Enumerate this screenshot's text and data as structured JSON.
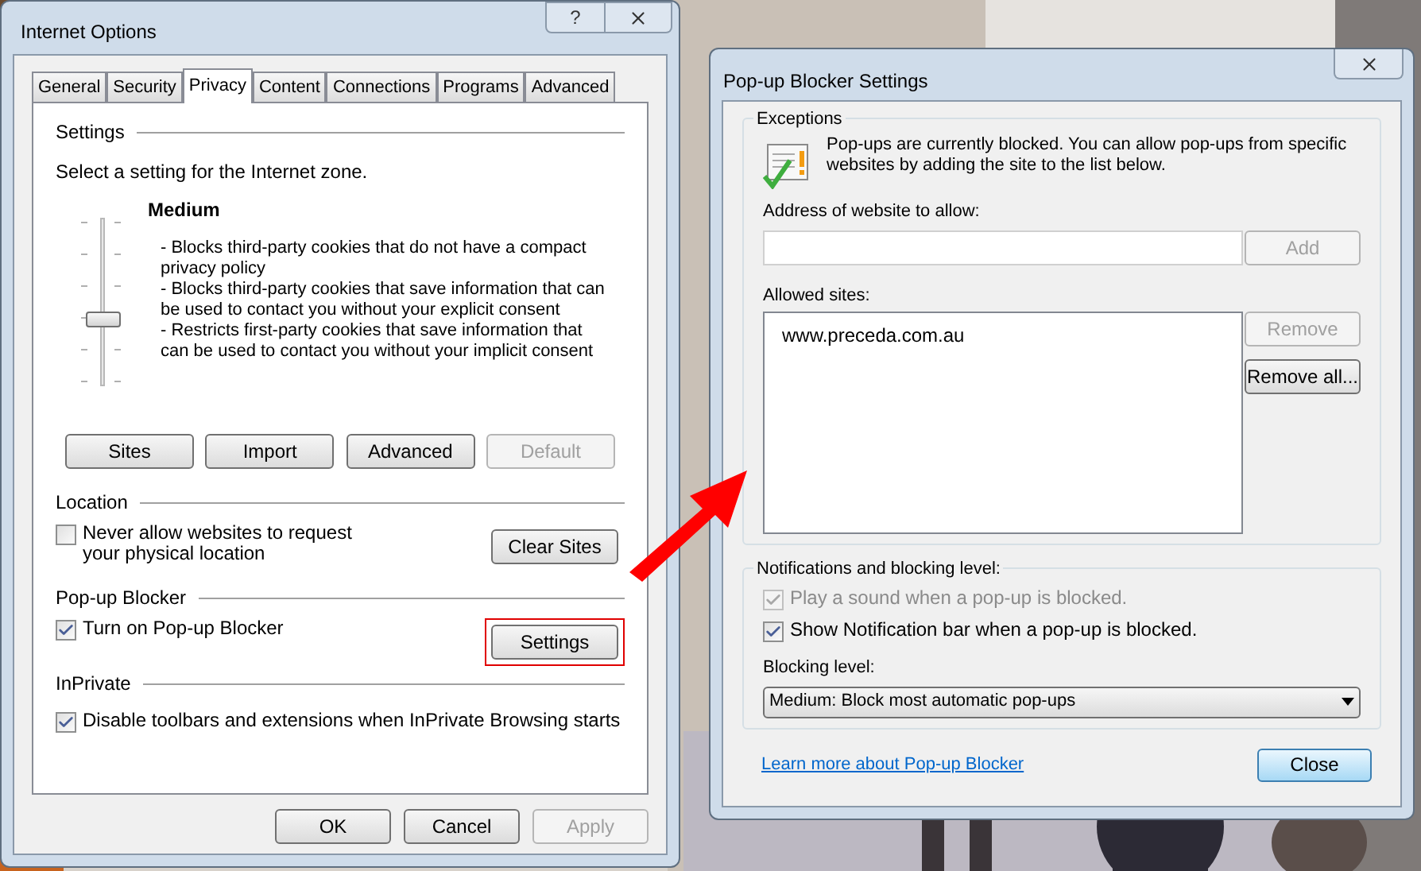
{
  "internet_options": {
    "title": "Internet Options",
    "help_button": "?",
    "tabs": [
      {
        "label": "General",
        "selected": false
      },
      {
        "label": "Security",
        "selected": false
      },
      {
        "label": "Privacy",
        "selected": true
      },
      {
        "label": "Content",
        "selected": false
      },
      {
        "label": "Connections",
        "selected": false
      },
      {
        "label": "Programs",
        "selected": false
      },
      {
        "label": "Advanced",
        "selected": false
      }
    ],
    "settings": {
      "heading": "Settings",
      "instruction": "Select a setting for the Internet zone.",
      "slider": {
        "level": 0.4
      },
      "level_name": "Medium",
      "description": [
        "- Blocks third-party cookies that do not have a compact privacy policy",
        "- Blocks third-party cookies that save information that can be used to contact you without your explicit consent",
        "- Restricts first-party cookies that save information that can be used to contact you without your implicit consent"
      ],
      "buttons": [
        {
          "label": "Sites",
          "disabled": false
        },
        {
          "label": "Import",
          "disabled": false
        },
        {
          "label": "Advanced",
          "disabled": false
        },
        {
          "label": "Default",
          "disabled": true
        }
      ]
    },
    "location": {
      "heading": "Location",
      "checkbox": {
        "label": "Never allow websites to request your physical location",
        "checked": false
      },
      "button": {
        "label": "Clear Sites",
        "highlighted": false
      }
    },
    "popup_blocker": {
      "heading": "Pop-up Blocker",
      "checkbox": {
        "label": "Turn on Pop-up Blocker",
        "checked": true
      },
      "button": {
        "label": "Settings",
        "highlighted": true
      }
    },
    "inprivate": {
      "heading": "InPrivate",
      "checkbox": {
        "label": "Disable toolbars and extensions when InPrivate Browsing starts",
        "checked": true
      }
    },
    "footer_buttons": [
      {
        "label": "OK",
        "disabled": false
      },
      {
        "label": "Cancel",
        "disabled": false
      },
      {
        "label": "Apply",
        "disabled": true
      }
    ]
  },
  "popup_settings": {
    "title": "Pop-up Blocker Settings",
    "exceptions": {
      "heading": "Exceptions",
      "info": "Pop-ups are currently blocked.  You can allow pop-ups from specific websites by adding the site to the list below.",
      "address_label": "Address of website to allow:",
      "add_button": {
        "label": "Add",
        "disabled": true
      },
      "allowed_label": "Allowed sites:",
      "allowed_sites": [
        "www.preceda.com.au"
      ],
      "list_buttons": [
        {
          "label": "Remove",
          "disabled": true
        },
        {
          "label": "Remove all...",
          "disabled": false
        }
      ]
    },
    "notifications": {
      "heading": "Notifications and blocking level:",
      "checkboxes": [
        {
          "label": "Play a sound when a pop-up is blocked.",
          "checked": true,
          "disabled": true
        },
        {
          "label": "Show Notification bar when a pop-up is blocked.",
          "checked": true,
          "disabled": false
        }
      ],
      "blocking_label": "Blocking level:",
      "blocking_value": "Medium: Block most automatic pop-ups"
    },
    "link": "Learn more about Pop-up Blocker",
    "close_button": "Close"
  }
}
